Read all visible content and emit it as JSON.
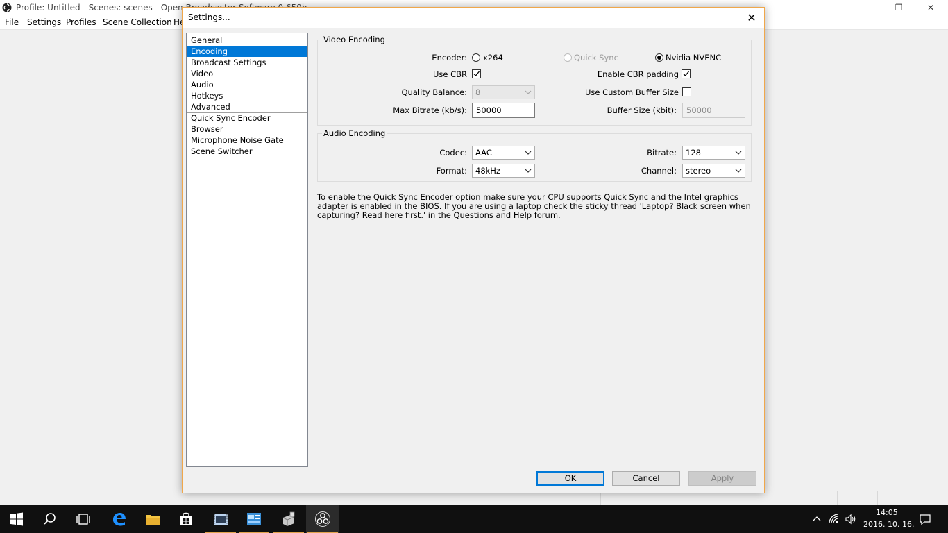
{
  "main_window": {
    "title": "Profile: Untitled - Scenes: scenes - Open Broadcaster Software 0.659b",
    "menu": [
      "File",
      "Settings",
      "Profiles",
      "Scene Collection",
      "Help"
    ],
    "controls": {
      "minimize": "—",
      "restore": "❐",
      "close": "✕"
    }
  },
  "dialog": {
    "title": "Settings...",
    "close": "✕",
    "nav": {
      "items": [
        "General",
        "Encoding",
        "Broadcast Settings",
        "Video",
        "Audio",
        "Hotkeys",
        "Advanced"
      ],
      "plugin_items": [
        "Quick Sync Encoder",
        "Browser",
        "Microphone Noise Gate",
        "Scene Switcher"
      ],
      "selected": "Encoding"
    },
    "video_encoding": {
      "title": "Video Encoding",
      "encoder_label": "Encoder:",
      "encoder_options": [
        "x264",
        "Quick Sync",
        "Nvidia NVENC"
      ],
      "encoder_selected": "Nvidia NVENC",
      "use_cbr_label": "Use CBR",
      "use_cbr_checked": true,
      "enable_cbr_padding_label": "Enable CBR padding",
      "enable_cbr_padding_checked": true,
      "quality_balance_label": "Quality Balance:",
      "quality_balance_value": "8",
      "use_custom_buffer_label": "Use Custom Buffer Size",
      "use_custom_buffer_checked": false,
      "max_bitrate_label": "Max Bitrate (kb/s):",
      "max_bitrate_value": "50000",
      "buffer_size_label": "Buffer Size (kbit):",
      "buffer_size_value": "50000"
    },
    "audio_encoding": {
      "title": "Audio Encoding",
      "codec_label": "Codec:",
      "codec_value": "AAC",
      "bitrate_label": "Bitrate:",
      "bitrate_value": "128",
      "format_label": "Format:",
      "format_value": "48kHz",
      "channel_label": "Channel:",
      "channel_value": "stereo"
    },
    "info_text": "To enable the Quick Sync Encoder option make sure your CPU supports Quick Sync and the Intel graphics adapter is enabled in the BIOS. If you are using a laptop check the sticky thread 'Laptop? Black screen when capturing? Read here first.' in the Questions and Help forum.",
    "buttons": {
      "ok": "OK",
      "cancel": "Cancel",
      "apply": "Apply"
    }
  },
  "taskbar": {
    "icons": [
      "windows-start-icon",
      "search-icon",
      "task-view-icon",
      "edge-icon",
      "file-explorer-icon",
      "store-icon",
      "video-app-icon",
      "control-panel-icon",
      "app-icon",
      "obs-icon"
    ],
    "time": "14:05",
    "date": "2016. 10. 16."
  },
  "colors": {
    "accent": "#0078d7",
    "dialog_border": "#f0a74a",
    "taskbar": "#101010"
  }
}
